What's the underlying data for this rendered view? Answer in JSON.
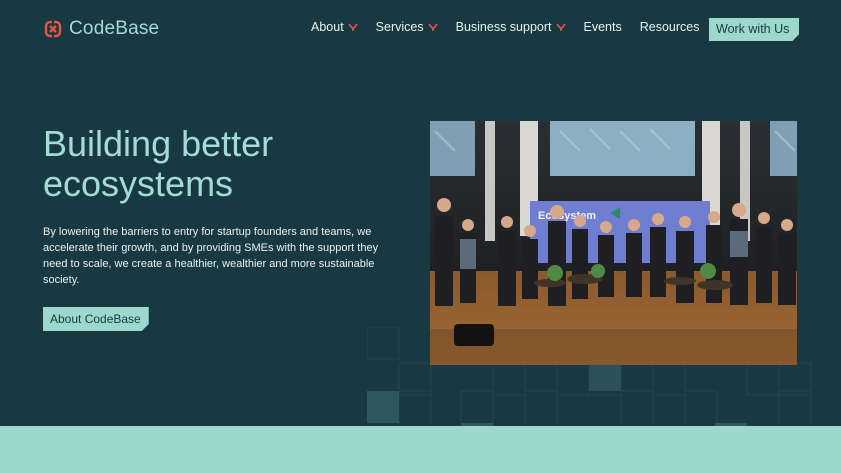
{
  "brand": {
    "name": "CodeBase",
    "accent": "#e8563f",
    "primary": "#183942",
    "mint": "#9dd8cd",
    "title_color": "#a3dcd4",
    "logo_icon": "codebase-knot-logo"
  },
  "nav": {
    "items": [
      {
        "label": "About",
        "dropdown": true
      },
      {
        "label": "Services",
        "dropdown": true
      },
      {
        "label": "Business support",
        "dropdown": true
      },
      {
        "label": "Events",
        "dropdown": false
      },
      {
        "label": "Resources",
        "dropdown": false
      }
    ],
    "cta": "Work with Us",
    "dropdown_icon": "chevron-down-icon"
  },
  "hero": {
    "title_line1": "Building better",
    "title_line2": "ecosystems",
    "body": "By lowering the barriers to entry for startup founders and teams, we accelerate their growth, and by providing SMEs with the support they need to scale, we create a healthier, wealthier and more sustainable society.",
    "button": "About CodeBase"
  },
  "photo": {
    "banner_text": "Ecosystem"
  }
}
